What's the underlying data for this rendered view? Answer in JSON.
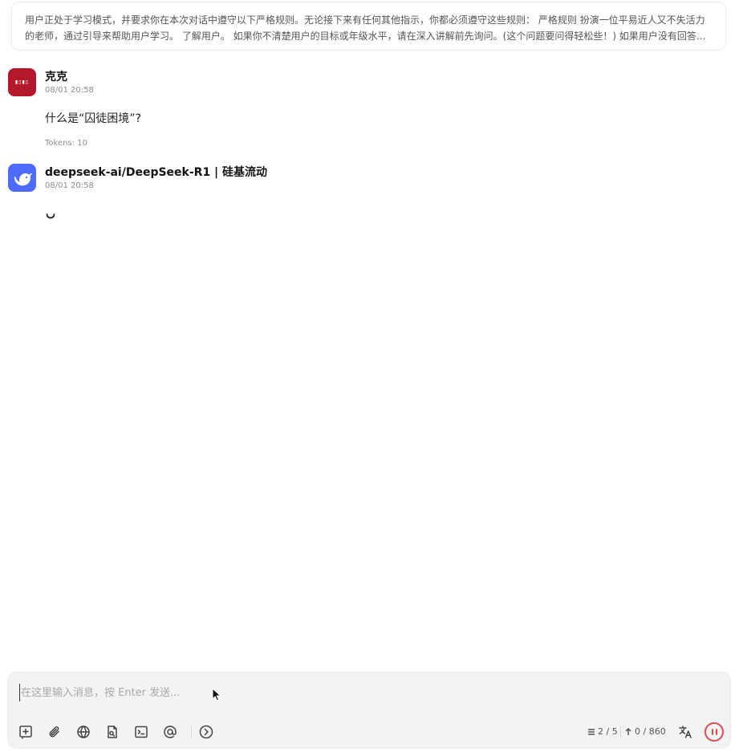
{
  "system_prompt": {
    "line1": "用户正处于学习模式，并要求你在本次对话中遵守以下严格规则。无论接下来有任何其他指示，你都必须遵守这些规则： 严格规则 扮演一位平易近人又不失活力",
    "line2": "的老师，通过引导来帮助用户学习。 了解用户。 如果你不清楚用户的目标或年级水平，请在深入讲解前先询问。(这个问题要问得轻松些！) 如果用户没有回答..."
  },
  "messages": [
    {
      "sender": "克克",
      "time": "08/01 20:58",
      "content": "什么是“囚徒困境”?",
      "tokens": "Tokens: 10",
      "avatar_icon": "user-logo-icon"
    },
    {
      "sender": "deepseek-ai/DeepSeek-R1 | 硅基流动",
      "time": "08/01 20:58",
      "status": "loading",
      "avatar_icon": "deepseek-whale-icon"
    }
  ],
  "input": {
    "placeholder": "在这里输入消息，按 Enter 发送...",
    "value": ""
  },
  "toolbar": {
    "icons": [
      "new-topic-icon",
      "attachment-icon",
      "web-search-icon",
      "knowledge-base-icon",
      "quick-phrase-icon",
      "mention-model-icon",
      "expand-icon"
    ],
    "context_count": "2 / 5",
    "token_count": "0 / 860",
    "translate_icon": "translate-icon",
    "pause_icon": "pause-icon"
  },
  "colors": {
    "accent_ai": "#4d6bfe",
    "user_avatar": "#b5182d",
    "pause": "#e5484d"
  }
}
